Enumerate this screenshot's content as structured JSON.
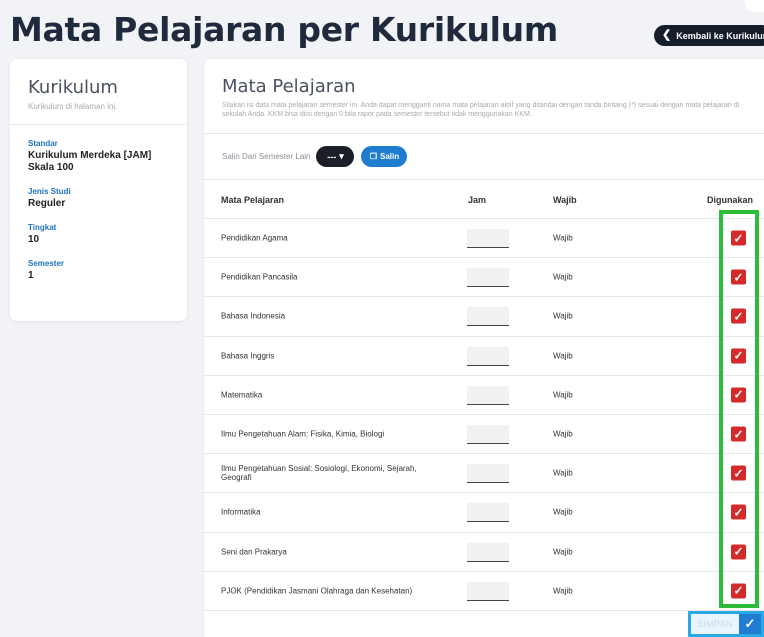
{
  "page": {
    "title": "Mata Pelajaran per Kurikulum",
    "back_label": "Kembali ke Kurikulum"
  },
  "kurikulum": {
    "title": "Kurikulum",
    "subtitle": "Kurikulum di halaman ini.",
    "fields": [
      {
        "label": "Standar",
        "value": "Kurikulum Merdeka [JAM] Skala 100"
      },
      {
        "label": "Jenis Studi",
        "value": "Reguler"
      },
      {
        "label": "Tingkat",
        "value": "10"
      },
      {
        "label": "Semester",
        "value": "1"
      }
    ]
  },
  "mapel": {
    "title": "Mata Pelajaran",
    "description": "Silakan isi data mata pelajaran semester ini. Anda dapat mengganti nama mata pelajaran aktif yang ditandai dengan tanda bintang (*) sesuai dengan mata pelajaran di sekolah Anda. KKM bisa diisi dengan 0 bila rapor pada semester tersebut tidak menggunakan KKM.",
    "copy_label": "Salin Dari Semester Lain",
    "semester_select": "---",
    "salin_label": "Salin",
    "columns": {
      "name": "Mata Pelajaran",
      "jam": "Jam",
      "wajib": "Wajib",
      "used": "Digunakan"
    },
    "rows": [
      {
        "name": "Pendidikan Agama",
        "jam": "",
        "wajib": "Wajib",
        "used": true
      },
      {
        "name": "Pendidikan Pancasila",
        "jam": "",
        "wajib": "Wajib",
        "used": true
      },
      {
        "name": "Bahasa Indonesia",
        "jam": "",
        "wajib": "Wajib",
        "used": true
      },
      {
        "name": "Bahasa Inggris",
        "jam": "",
        "wajib": "Wajib",
        "used": true
      },
      {
        "name": "Matematika",
        "jam": "",
        "wajib": "Wajib",
        "used": true
      },
      {
        "name": "Ilmu Pengetahuan Alam: Fisika, Kimia, Biologi",
        "jam": "",
        "wajib": "Wajib",
        "used": true
      },
      {
        "name": "Ilmu Pengetahuan Sosial: Sosiologi, Ekonomi, Sejarah, Geografi",
        "jam": "",
        "wajib": "Wajib",
        "used": true
      },
      {
        "name": "Informatika",
        "jam": "",
        "wajib": "Wajib",
        "used": true
      },
      {
        "name": "Seni dan Prakarya",
        "jam": "",
        "wajib": "Wajib",
        "used": true
      },
      {
        "name": "PJOK (Pendidikan Jasmani Olahraga dan Kesehatan)",
        "jam": "",
        "wajib": "Wajib",
        "used": true
      }
    ],
    "save_label": "SIMPAN"
  },
  "colors": {
    "accent": "#1f7cd0",
    "checkbox": "#d42a2a",
    "highlight_green": "#2dbb3a",
    "highlight_blue": "#29a9e6"
  }
}
